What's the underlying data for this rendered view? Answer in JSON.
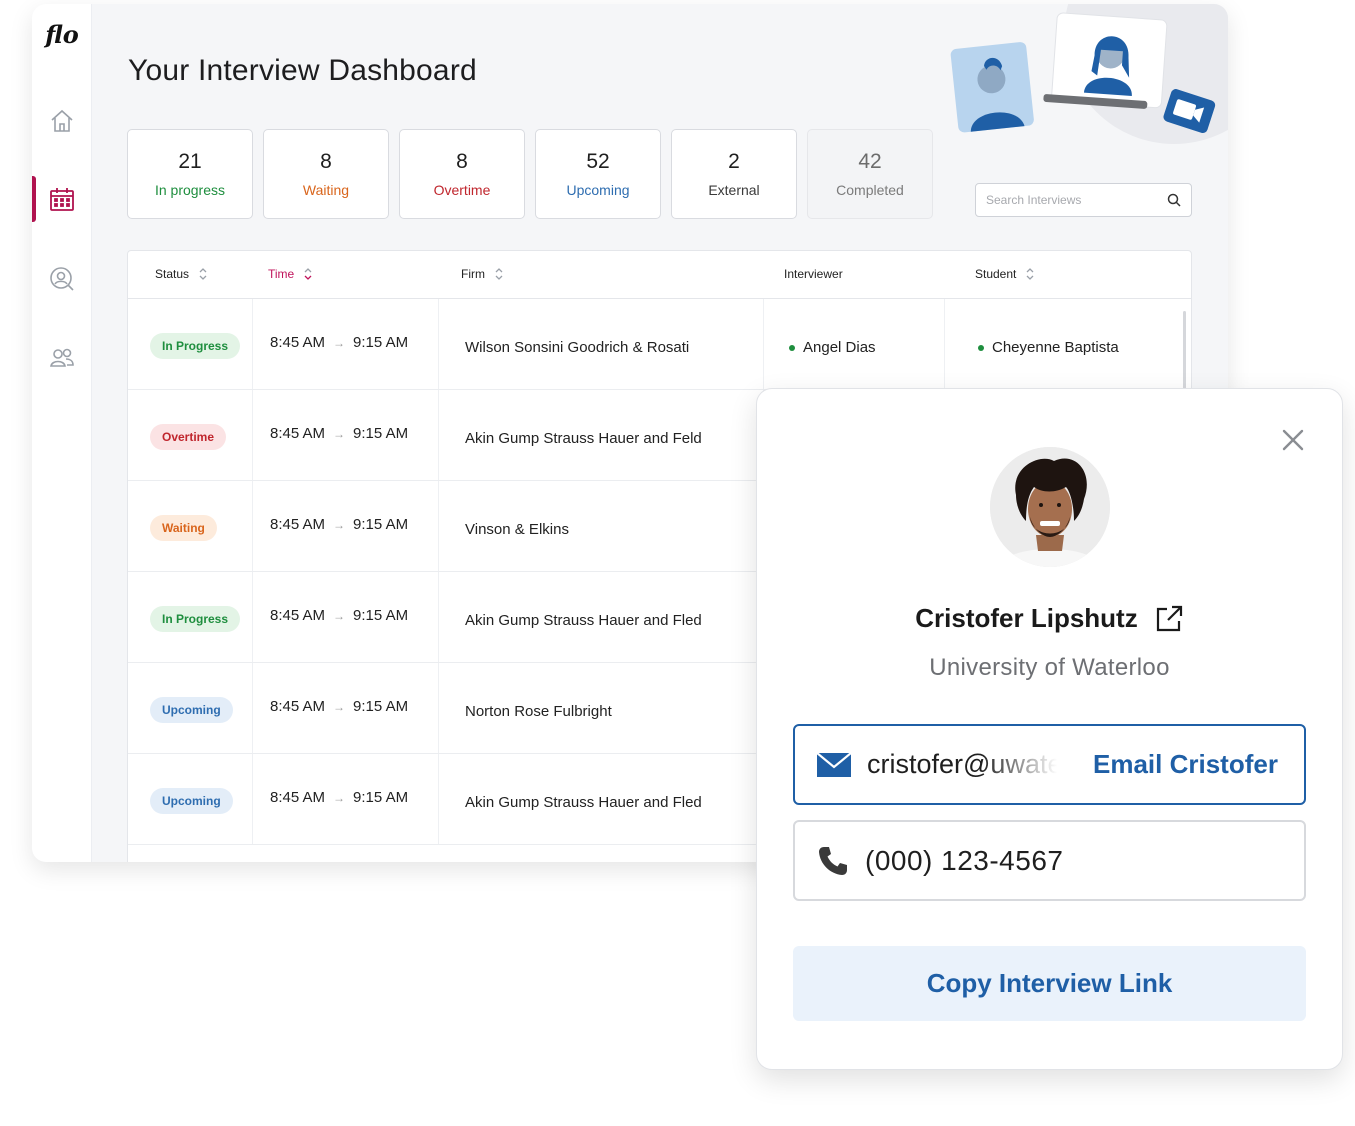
{
  "app": {
    "logo": "flo",
    "title": "Your Interview Dashboard"
  },
  "sidebar": {
    "items": [
      {
        "name": "home",
        "icon": "home-icon",
        "active": false
      },
      {
        "name": "calendar",
        "icon": "calendar-icon",
        "active": true
      },
      {
        "name": "interviewer",
        "icon": "user-search-icon",
        "active": false
      },
      {
        "name": "people",
        "icon": "people-icon",
        "active": false
      }
    ],
    "accent": "#b0124f"
  },
  "stats": [
    {
      "num": "21",
      "label": "In progress",
      "color": "#1e8e3e",
      "muted": false
    },
    {
      "num": "8",
      "label": "Waiting",
      "color": "#d9651c",
      "muted": false
    },
    {
      "num": "8",
      "label": "Overtime",
      "color": "#c0262d",
      "muted": false
    },
    {
      "num": "52",
      "label": "Upcoming",
      "color": "#2e6db0",
      "muted": false
    },
    {
      "num": "2",
      "label": "External",
      "color": "#3a3a3a",
      "muted": false
    },
    {
      "num": "42",
      "label": "Completed",
      "color": "#7b7b7b",
      "muted": true
    }
  ],
  "search": {
    "placeholder": "Search Interviews"
  },
  "table": {
    "headers": {
      "status": "Status",
      "time": "Time",
      "firm": "Firm",
      "interviewer": "Interviewer",
      "student": "Student"
    },
    "rows": [
      {
        "status": "In Progress",
        "kind": "progress",
        "start": "8:45 AM",
        "end": "9:15 AM",
        "firm": "Wilson Sonsini Goodrich & Rosati",
        "interviewer": "Angel Dias",
        "student": "Cheyenne Baptista"
      },
      {
        "status": "Overtime",
        "kind": "overtime",
        "start": "8:45 AM",
        "end": "9:15 AM",
        "firm": "Akin Gump Strauss Hauer and Feld"
      },
      {
        "status": "Waiting",
        "kind": "waiting",
        "start": "8:45 AM",
        "end": "9:15 AM",
        "firm": "Vinson & Elkins"
      },
      {
        "status": "In Progress",
        "kind": "progress",
        "start": "8:45 AM",
        "end": "9:15 AM",
        "firm": "Akin Gump Strauss Hauer and Fled"
      },
      {
        "status": "Upcoming",
        "kind": "upcoming",
        "start": "8:45 AM",
        "end": "9:15 AM",
        "firm": "Norton Rose Fulbright"
      },
      {
        "status": "Upcoming",
        "kind": "upcoming",
        "start": "8:45 AM",
        "end": "9:15 AM",
        "firm": "Akin Gump Strauss Hauer and Fled"
      }
    ],
    "arrow": "→"
  },
  "badge_colors": {
    "progress": {
      "bg": "#e3f4e6",
      "fg": "#1e8e3e"
    },
    "overtime": {
      "bg": "#fbe3e4",
      "fg": "#c0262d"
    },
    "waiting": {
      "bg": "#fdebdc",
      "fg": "#d9651c"
    },
    "upcoming": {
      "bg": "#e3edf8",
      "fg": "#2e6db0"
    }
  },
  "profile": {
    "name": "Cristofer Lipshutz",
    "school": "University of Waterloo",
    "email": "cristofer@uwaterloo.ca",
    "email_action": "Email Cristofer",
    "phone": "(000) 123-4567",
    "copy_link": "Copy Interview Link"
  }
}
